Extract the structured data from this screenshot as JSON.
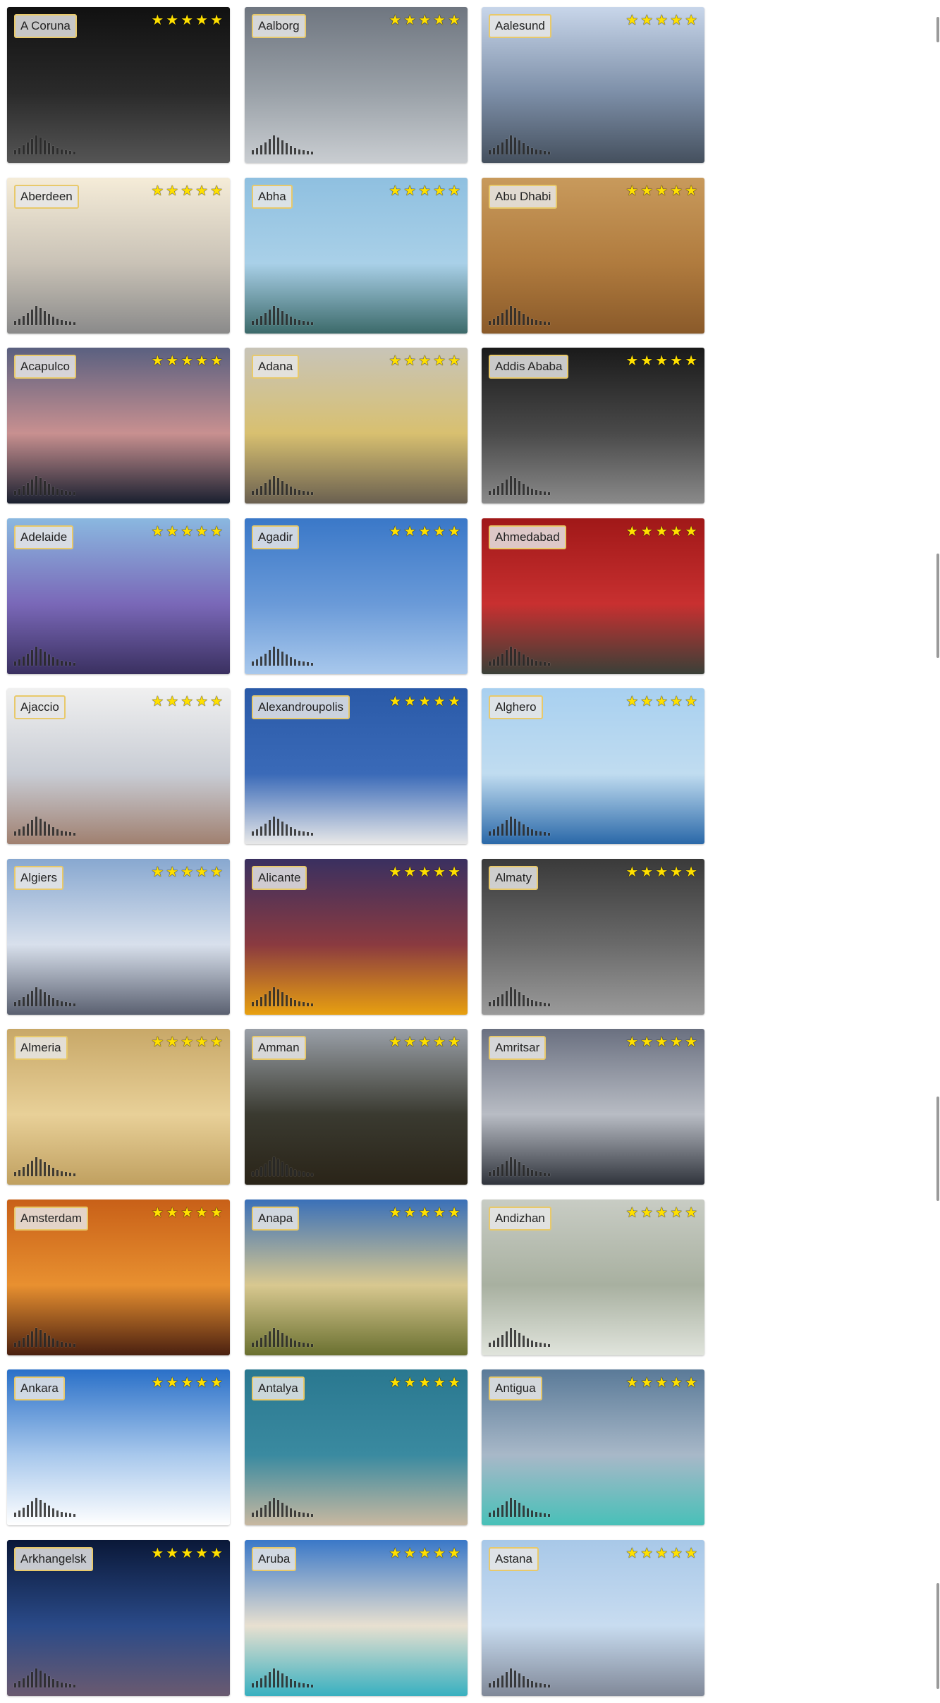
{
  "cities": [
    {
      "name": "A Coruna",
      "rating": 5,
      "colors": [
        "#111111",
        "#2a2a2a",
        "#555555"
      ]
    },
    {
      "name": "Aalborg",
      "rating": 5,
      "colors": [
        "#6f7680",
        "#9aa1a8",
        "#c9cdd1"
      ]
    },
    {
      "name": "Aalesund",
      "rating": 5,
      "colors": [
        "#c8d6ea",
        "#7d8fa8",
        "#45505e"
      ]
    },
    {
      "name": "Aberdeen",
      "rating": 5,
      "colors": [
        "#f5ecd8",
        "#c9c2b6",
        "#8a8a8a"
      ]
    },
    {
      "name": "Abha",
      "rating": 5,
      "colors": [
        "#8fc0e0",
        "#a9d0e8",
        "#3c6a6a"
      ]
    },
    {
      "name": "Abu Dhabi",
      "rating": 5,
      "colors": [
        "#c89a5c",
        "#b07b3e",
        "#8a5a2a"
      ]
    },
    {
      "name": "Acapulco",
      "rating": 5,
      "colors": [
        "#5a6080",
        "#c89090",
        "#1a2030"
      ]
    },
    {
      "name": "Adana",
      "rating": 5,
      "colors": [
        "#c8c4b8",
        "#d8c070",
        "#6a6050"
      ]
    },
    {
      "name": "Addis Ababa",
      "rating": 5,
      "colors": [
        "#1a1a1a",
        "#4a4a4a",
        "#8a8a8a"
      ]
    },
    {
      "name": "Adelaide",
      "rating": 5,
      "colors": [
        "#8ab8e0",
        "#7a68b8",
        "#3a3060"
      ]
    },
    {
      "name": "Agadir",
      "rating": 5,
      "colors": [
        "#3a78c8",
        "#6a9ad8",
        "#a8c8ec"
      ]
    },
    {
      "name": "Ahmedabad",
      "rating": 5,
      "colors": [
        "#a01818",
        "#c83030",
        "#3a4038"
      ]
    },
    {
      "name": "Ajaccio",
      "rating": 5,
      "colors": [
        "#f0f0f0",
        "#c8ccd4",
        "#a08070"
      ]
    },
    {
      "name": "Alexandroupolis",
      "rating": 5,
      "colors": [
        "#2a5aa8",
        "#3a6ab8",
        "#e8e8e8"
      ]
    },
    {
      "name": "Alghero",
      "rating": 5,
      "colors": [
        "#a8d0f0",
        "#c0dcf0",
        "#2a68a8"
      ]
    },
    {
      "name": "Algiers",
      "rating": 5,
      "colors": [
        "#88a8d0",
        "#d8e0ec",
        "#5a6070"
      ]
    },
    {
      "name": "Alicante",
      "rating": 5,
      "colors": [
        "#3a3060",
        "#8a3a40",
        "#e8a010"
      ]
    },
    {
      "name": "Almaty",
      "rating": 5,
      "colors": [
        "#3a3a3a",
        "#6a6a6a",
        "#9a9a9a"
      ]
    },
    {
      "name": "Almeria",
      "rating": 5,
      "colors": [
        "#c8a868",
        "#e8d098",
        "#c0a060"
      ]
    },
    {
      "name": "Amman",
      "rating": 5,
      "colors": [
        "#9aa0a8",
        "#3a3a30",
        "#2a2418"
      ]
    },
    {
      "name": "Amritsar",
      "rating": 5,
      "colors": [
        "#6a7080",
        "#b8bcc4",
        "#30343c"
      ]
    },
    {
      "name": "Amsterdam",
      "rating": 5,
      "colors": [
        "#c86018",
        "#e89030",
        "#4a2010"
      ]
    },
    {
      "name": "Anapa",
      "rating": 5,
      "colors": [
        "#3a70b8",
        "#d8c890",
        "#6a7030"
      ]
    },
    {
      "name": "Andizhan",
      "rating": 5,
      "colors": [
        "#c8ccc4",
        "#a8b0a0",
        "#e0e4dc"
      ]
    },
    {
      "name": "Ankara",
      "rating": 5,
      "colors": [
        "#2a70c8",
        "#a8c8ec",
        "#ffffff"
      ]
    },
    {
      "name": "Antalya",
      "rating": 5,
      "colors": [
        "#2a7890",
        "#3a8aa0",
        "#c8b8a0"
      ]
    },
    {
      "name": "Antigua",
      "rating": 5,
      "colors": [
        "#5a7a98",
        "#a8b8c8",
        "#48c0b8"
      ]
    },
    {
      "name": "Arkhangelsk",
      "rating": 5,
      "colors": [
        "#0a1838",
        "#2a4a88",
        "#6a5a70"
      ]
    },
    {
      "name": "Aruba",
      "rating": 5,
      "colors": [
        "#3a78c8",
        "#e8e0d0",
        "#38b0c0"
      ]
    },
    {
      "name": "Astana",
      "rating": 5,
      "colors": [
        "#a8c8e8",
        "#c8dcf0",
        "#808898"
      ]
    }
  ]
}
